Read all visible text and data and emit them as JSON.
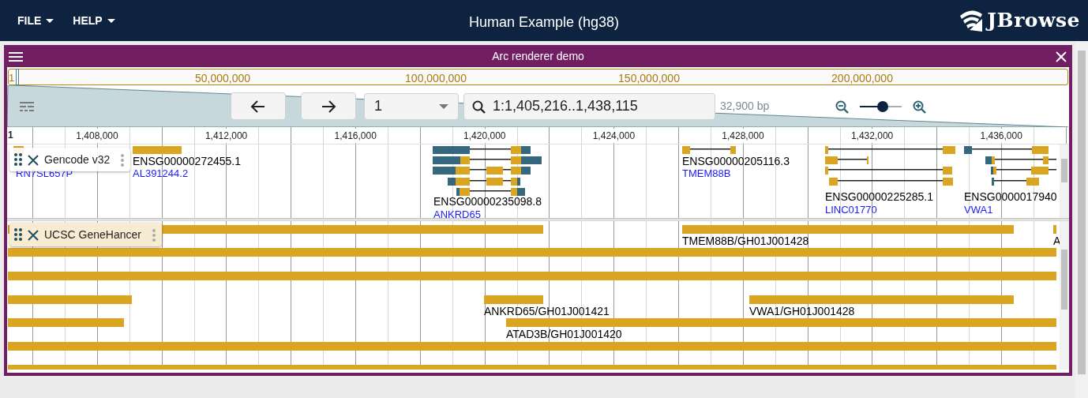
{
  "app_bar": {
    "menus": [
      {
        "label": "FILE"
      },
      {
        "label": "HELP"
      }
    ],
    "title": "Human Example (hg38)",
    "logo": "JBrowse"
  },
  "view": {
    "title": "Arc renderer demo",
    "overview": {
      "start": "1",
      "ticks": [
        "50,000,000",
        "100,000,000",
        "150,000,000",
        "200,000,000"
      ]
    },
    "chromosome": "1",
    "location": "1:1,405,216..1,438,115",
    "span": "32,900 bp",
    "zoom": {
      "level": 0.55
    },
    "ruler": {
      "chromosome": "1",
      "ticks": [
        "1,408,000",
        "1,412,000",
        "1,416,000",
        "1,420,000",
        "1,424,000",
        "1,428,000",
        "1,432,000",
        "1,436,000"
      ]
    },
    "tracks": [
      {
        "kind": "gene",
        "name": "Gencode v32",
        "features": [
          {
            "gene": "RN7SL657P"
          },
          {
            "id": "ENSG00000272455.1",
            "gene": "AL391244.2"
          },
          {
            "id": "ENSG00000235098.8",
            "gene": "ANKRD65"
          },
          {
            "id": "ENSG00000205116.3",
            "gene": "TMEM88B"
          },
          {
            "id": "ENSG00000225285.1",
            "gene": "LINC01770"
          },
          {
            "id": "ENSG0000017940",
            "gene": "VWA1"
          }
        ]
      },
      {
        "kind": "bar",
        "name": "UCSC GeneHancer",
        "features": [
          {
            "label": "TMEM88B/GH01J001428"
          },
          {
            "label": "A"
          },
          {
            "label": "ANKRD65/GH01J001421"
          },
          {
            "label": "VWA1/GH01J001428"
          },
          {
            "label": "ATAD3B/GH01J001420"
          }
        ]
      }
    ]
  }
}
